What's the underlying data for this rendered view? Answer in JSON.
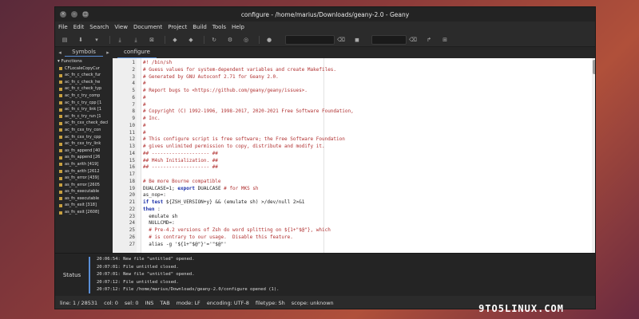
{
  "window": {
    "title": "configure - /home/marius/Downloads/geany-2.0 - Geany"
  },
  "menu": [
    "File",
    "Edit",
    "Search",
    "View",
    "Document",
    "Project",
    "Build",
    "Tools",
    "Help"
  ],
  "toolbar": {
    "icons": [
      "new-file-icon",
      "open-icon",
      "save-icon",
      "save-all-icon",
      "revert-icon",
      "close-icon",
      "back-icon",
      "forward-icon",
      "compile-icon",
      "build-icon",
      "run-icon",
      "color-icon"
    ]
  },
  "sidebar": {
    "tab_label": "Symbols",
    "root": "Functions",
    "items": [
      "CFLocaleCopyCur",
      "ac_fn_c_check_fur",
      "ac_fn_c_check_he",
      "ac_fn_c_check_typ",
      "ac_fn_c_try_comp",
      "ac_fn_c_try_cpp [1",
      "ac_fn_c_try_link [1",
      "ac_fn_c_try_run [1",
      "ac_fn_cxx_check_decl",
      "ac_fn_cxx_try_con",
      "ac_fn_cxx_try_cpp",
      "ac_fn_cxx_try_link",
      "as_fn_append [40",
      "as_fn_append [26",
      "as_fn_arith [419]",
      "as_fn_arith [2612",
      "as_fn_error [439]",
      "as_fn_error [2605",
      "as_fn_executable",
      "as_fn_executable",
      "as_fn_exit [318]",
      "as_fn_exit [2608]"
    ]
  },
  "editor": {
    "tab_label": "configure",
    "lines": [
      {
        "n": "1",
        "segs": [
          {
            "c": "cm",
            "t": "#! /bin/sh"
          }
        ]
      },
      {
        "n": "2",
        "segs": [
          {
            "c": "cm",
            "t": "# Guess values for system-dependent variables and create Makefiles."
          }
        ]
      },
      {
        "n": "3",
        "segs": [
          {
            "c": "cm",
            "t": "# Generated by GNU Autoconf 2.71 for Geany 2.0."
          }
        ]
      },
      {
        "n": "4",
        "segs": [
          {
            "c": "cm",
            "t": "#"
          }
        ]
      },
      {
        "n": "5",
        "segs": [
          {
            "c": "cm",
            "t": "# Report bugs to <https://github.com/geany/geany/issues>."
          }
        ]
      },
      {
        "n": "6",
        "segs": [
          {
            "c": "cm",
            "t": "#"
          }
        ]
      },
      {
        "n": "7",
        "segs": [
          {
            "c": "cm",
            "t": "#"
          }
        ]
      },
      {
        "n": "8",
        "segs": [
          {
            "c": "cm",
            "t": "# Copyright (C) 1992-1996, 1998-2017, 2020-2021 Free Software Foundation,"
          }
        ]
      },
      {
        "n": "9",
        "segs": [
          {
            "c": "cm",
            "t": "# Inc."
          }
        ]
      },
      {
        "n": "10",
        "segs": [
          {
            "c": "cm",
            "t": "#"
          }
        ]
      },
      {
        "n": "11",
        "segs": [
          {
            "c": "cm",
            "t": "#"
          }
        ]
      },
      {
        "n": "12",
        "segs": [
          {
            "c": "cm",
            "t": "# This configure script is free software; the Free Software Foundation"
          }
        ]
      },
      {
        "n": "13",
        "segs": [
          {
            "c": "cm",
            "t": "# gives unlimited permission to copy, distribute and modify it."
          }
        ]
      },
      {
        "n": "14",
        "segs": [
          {
            "c": "cm",
            "t": "## -------------------- ##"
          }
        ]
      },
      {
        "n": "15",
        "segs": [
          {
            "c": "cm",
            "t": "## M4sh Initialization. ##"
          }
        ]
      },
      {
        "n": "16",
        "segs": [
          {
            "c": "cm",
            "t": "## -------------------- ##"
          }
        ]
      },
      {
        "n": "17",
        "segs": [
          {
            "c": "",
            "t": ""
          }
        ]
      },
      {
        "n": "18",
        "segs": [
          {
            "c": "cm",
            "t": "# Be more Bourne compatible"
          }
        ]
      },
      {
        "n": "19",
        "segs": [
          {
            "c": "",
            "t": "DUALCASE=1; "
          },
          {
            "c": "kw",
            "t": "export"
          },
          {
            "c": "",
            "t": " DUALCASE "
          },
          {
            "c": "cm",
            "t": "# for MKS sh"
          }
        ]
      },
      {
        "n": "20",
        "segs": [
          {
            "c": "",
            "t": "as_nop=:"
          }
        ]
      },
      {
        "n": "21",
        "segs": [
          {
            "c": "kw",
            "t": "if test"
          },
          {
            "c": "",
            "t": " ${ZSH_VERSION+y} && (emulate sh) >/dev/null 2>&1"
          }
        ]
      },
      {
        "n": "22",
        "segs": [
          {
            "c": "kw",
            "t": "then"
          },
          {
            "c": "",
            "t": " :"
          }
        ]
      },
      {
        "n": "23",
        "segs": [
          {
            "c": "",
            "t": "  emulate sh"
          }
        ]
      },
      {
        "n": "24",
        "segs": [
          {
            "c": "",
            "t": "  NULLCMD=:"
          }
        ]
      },
      {
        "n": "25",
        "segs": [
          {
            "c": "cm",
            "t": "  # Pre-4.2 versions of Zsh do word splitting on ${1+\"$@\"}, which"
          }
        ]
      },
      {
        "n": "26",
        "segs": [
          {
            "c": "cm",
            "t": "  # is contrary to our usage.  Disable this feature."
          }
        ]
      },
      {
        "n": "27",
        "segs": [
          {
            "c": "",
            "t": "  alias -g '${1+\"$@\"}'='\"$@\"'"
          }
        ]
      }
    ]
  },
  "messages": {
    "pane_label": "Status",
    "lines": [
      "20:06:54: New file \"untitled\" opened.",
      "20:07:01: File untitled closed.",
      "20:07:01: New file \"untitled\" opened.",
      "20:07:12: File untitled closed.",
      "20:07:12: File /home/marius/Downloads/geany-2.0/configure opened (1)."
    ]
  },
  "statusbar": {
    "line": "line: 1 / 28531",
    "col": "col: 0",
    "sel": "sel: 0",
    "ins": "INS",
    "tab": "TAB",
    "mode": "mode: LF",
    "encoding": "encoding: UTF-8",
    "filetype": "filetype: Sh",
    "scope": "scope: unknown"
  },
  "watermark": "9TO5LINUX.COM"
}
